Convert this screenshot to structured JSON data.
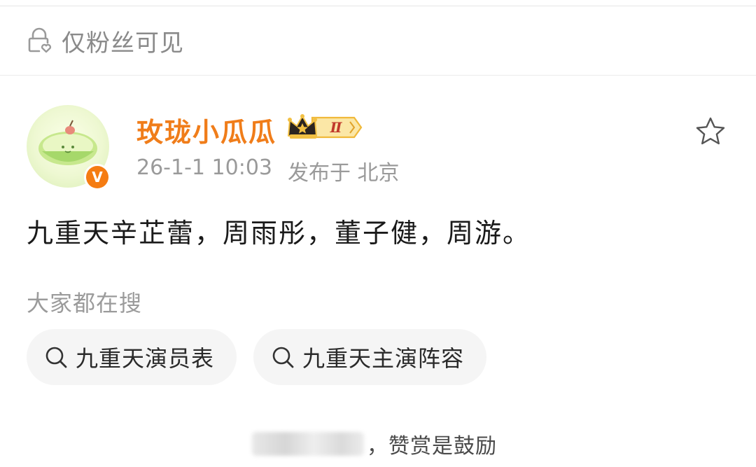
{
  "privacy": {
    "label": "仅粉丝可见",
    "icon": "lock-heart-icon"
  },
  "post": {
    "author": "玫珑小瓜瓜",
    "author_color": "#f07d1a",
    "member_level": "Ⅱ",
    "verified_mark": "V",
    "timestamp": "26-1-1 10:03",
    "location": "发布于 北京",
    "content": "九重天辛芷蕾，周雨彤，董子健，周游。"
  },
  "search": {
    "heading": "大家都在搜",
    "chips": [
      {
        "label": "九重天演员表"
      },
      {
        "label": "九重天主演阵容"
      }
    ]
  },
  "reward": {
    "text": "，赞赏是鼓励"
  }
}
